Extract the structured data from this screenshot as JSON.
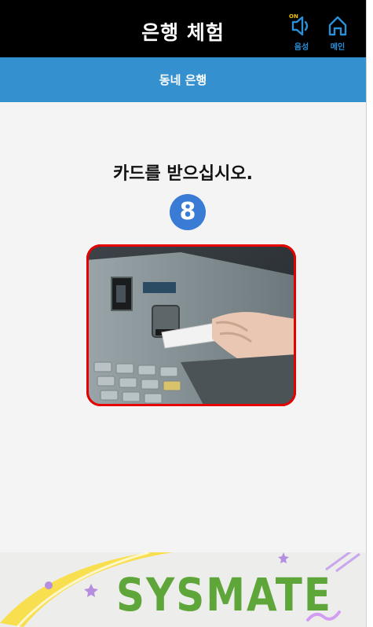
{
  "header": {
    "title": "은행 체험",
    "sound": {
      "label": "음성",
      "state": "ON"
    },
    "home": {
      "label": "메인"
    }
  },
  "subheader": {
    "title": "동네 은행"
  },
  "main": {
    "instruction": "카드를 받으십시오.",
    "step_number": "8"
  },
  "footer": {
    "logo": "SYSMATE"
  },
  "colors": {
    "header_bg": "#000000",
    "subheader_bg": "#3590cf",
    "step_badge": "#3a7bd5",
    "image_border": "#e60000",
    "icon_accent": "#2b8fd8",
    "logo_green": "#5fa63a"
  }
}
